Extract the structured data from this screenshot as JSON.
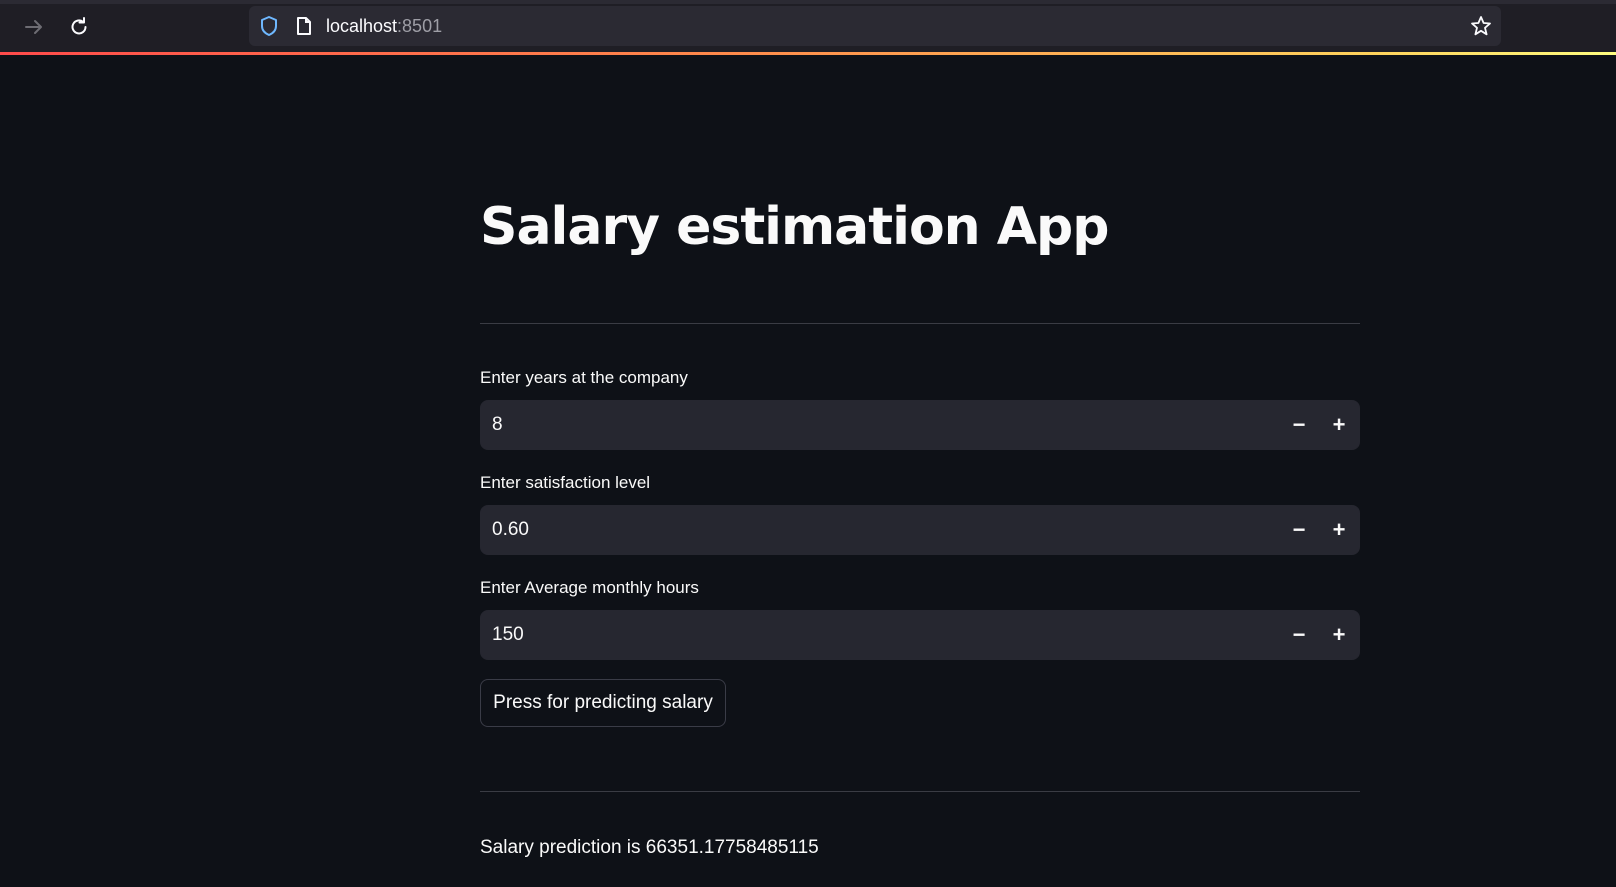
{
  "browser": {
    "url_host": "localhost",
    "url_port": ":8501"
  },
  "app": {
    "title": "Salary estimation App",
    "inputs": [
      {
        "label": "Enter years at the company",
        "value": "8"
      },
      {
        "label": "Enter satisfaction level",
        "value": "0.60"
      },
      {
        "label": "Enter Average monthly hours",
        "value": "150"
      }
    ],
    "stepper": {
      "minus": "−",
      "plus": "+"
    },
    "predict_button": "Press for predicting salary",
    "result_text": "Salary prediction is 66351.17758485115"
  },
  "colors": {
    "background": "#0e1117",
    "input_bg": "#262730",
    "text": "#fafafa",
    "accent_gradient_start": "#ff4b4b",
    "accent_gradient_end": "#fffd80"
  }
}
